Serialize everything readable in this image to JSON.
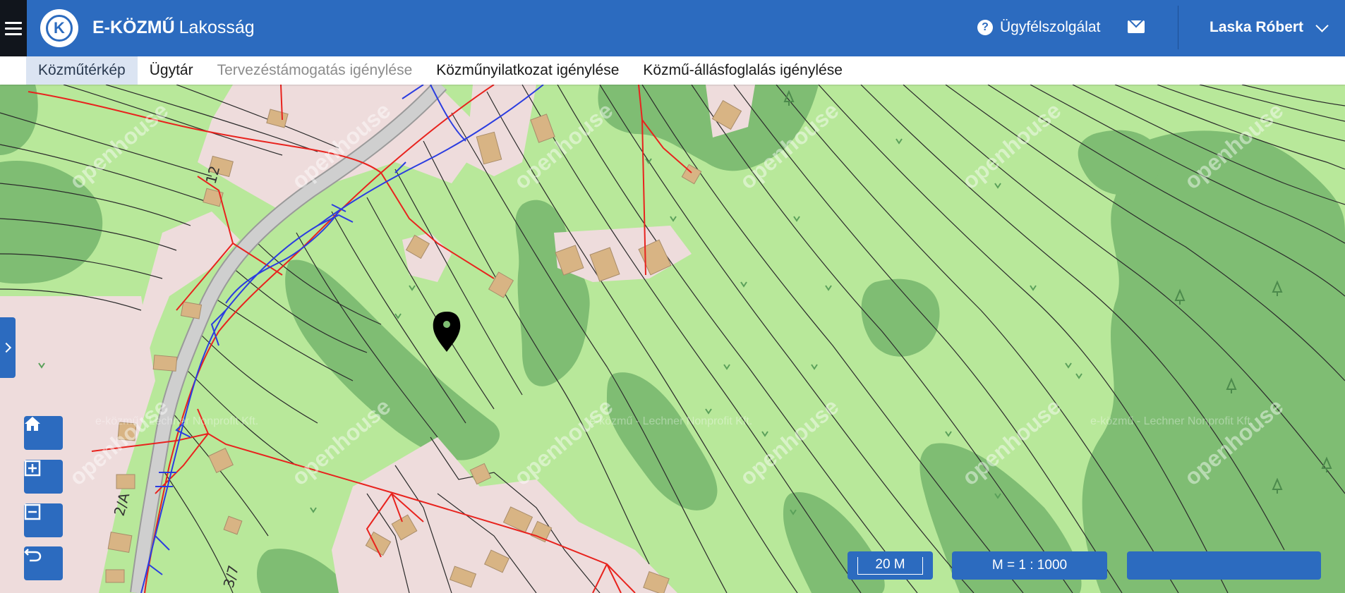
{
  "header": {
    "brand_bold": "E-KÖZMŰ",
    "brand_light": "Lakosság",
    "logo_letter": "K",
    "support_label": "Ügyfélszolgálat",
    "user_name": "Laska Róbert"
  },
  "nav": {
    "tabs": [
      {
        "label": "Közműtérkép",
        "state": "active"
      },
      {
        "label": "Ügytár",
        "state": "normal"
      },
      {
        "label": "Tervezéstámogatás igénylése",
        "state": "disabled"
      },
      {
        "label": "Közműnyilatkozat igénylése",
        "state": "normal"
      },
      {
        "label": "Közmű-állásfoglalás igénylése",
        "state": "normal"
      }
    ]
  },
  "map": {
    "house_labels": [
      "12",
      "2/A",
      "3/7"
    ],
    "watermark": "openhouse",
    "attribution": "e-közmű - Lechner Nonprofit Kft.",
    "scale_length": "20 M",
    "scale_ratio": "M = 1 : 1000",
    "coordinates": ""
  },
  "colors": {
    "header_bg": "#2c6bbf",
    "burger_bg": "#11151c",
    "map_grass": "#b8e89a",
    "map_forest": "#7fbd73",
    "map_residential": "#eedcdc",
    "building": "#d8b484",
    "electric_line": "#e8231e",
    "water_line": "#2b3de0",
    "road": "#c8c8c8"
  },
  "icons": [
    "menu-icon",
    "home-icon",
    "zoom-in-icon",
    "zoom-out-icon",
    "undo-icon",
    "chevron-right-icon",
    "help-icon",
    "mail-icon",
    "chevron-down-icon",
    "location-pin-icon"
  ]
}
